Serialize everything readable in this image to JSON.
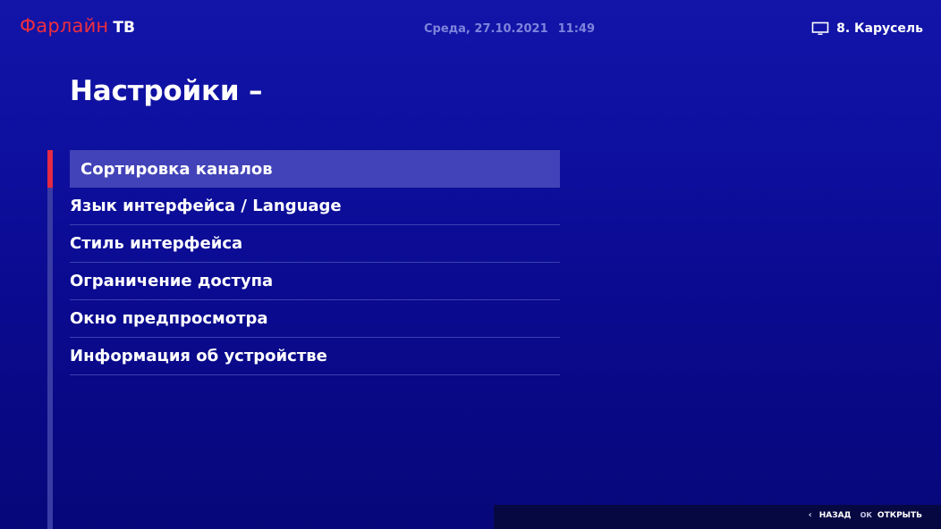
{
  "header": {
    "logo_main": "Фарлайн",
    "logo_tv": "ТВ",
    "day": "Среда, 27.10.2021",
    "time": "11:49",
    "channel": "8.  Карусель",
    "channel_icon": "tv-icon"
  },
  "page": {
    "title": "Настройки –"
  },
  "menu": {
    "selected_index": 0,
    "items": [
      {
        "label": "Сортировка каналов"
      },
      {
        "label": "Язык интерфейса / Language"
      },
      {
        "label": "Стиль интерфейса"
      },
      {
        "label": "Ограничение доступа"
      },
      {
        "label": "Окно предпросмотра"
      },
      {
        "label": "Информация об устройстве"
      }
    ]
  },
  "footer": {
    "back_icon": "chevron-left-icon",
    "back_label": "НАЗАД",
    "ok_key": "ОК",
    "open_label": "ОТКРЫТЬ"
  },
  "colors": {
    "accent_red": "#e42a44",
    "logo_red": "#ee2e3e",
    "background": "#0e10a0",
    "selected_bg": "#4243b8",
    "datetime": "#7e84dc"
  }
}
